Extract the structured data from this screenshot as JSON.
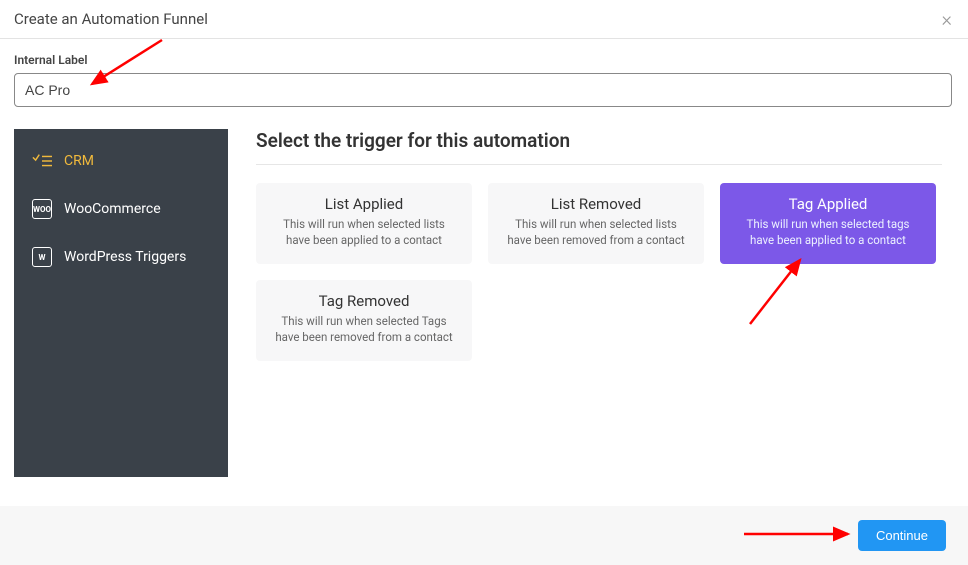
{
  "modal": {
    "title": "Create an Automation Funnel"
  },
  "form": {
    "label": "Internal Label",
    "value": "AC Pro"
  },
  "sidebar": {
    "items": [
      {
        "label": "CRM",
        "icon": "check-list-icon"
      },
      {
        "label": "WooCommerce",
        "icon": "woo-icon"
      },
      {
        "label": "WordPress Triggers",
        "icon": "wordpress-icon"
      }
    ]
  },
  "content": {
    "heading": "Select the trigger for this automation",
    "triggers": [
      {
        "title": "List Applied",
        "desc": "This will run when selected lists have been applied to a contact",
        "selected": false
      },
      {
        "title": "List Removed",
        "desc": "This will run when selected lists have been removed from a contact",
        "selected": false
      },
      {
        "title": "Tag Applied",
        "desc": "This will run when selected tags have been applied to a contact",
        "selected": true
      },
      {
        "title": "Tag Removed",
        "desc": "This will run when selected Tags have been removed from a contact",
        "selected": false
      }
    ]
  },
  "footer": {
    "continue": "Continue"
  }
}
